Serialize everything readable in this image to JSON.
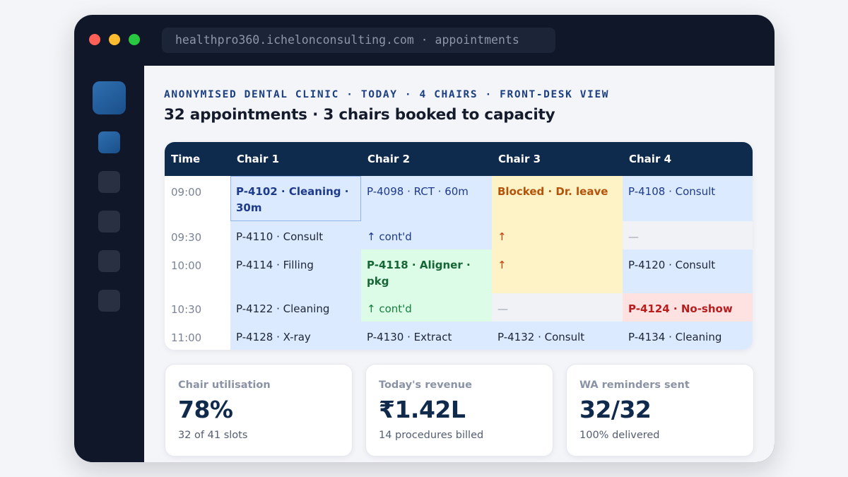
{
  "window": {
    "url": "healthpro360.ichelonconsulting.com · appointments"
  },
  "header": {
    "kicker": "ANONYMISED DENTAL CLINIC · TODAY · 4 CHAIRS · FRONT-DESK VIEW",
    "title": "32 appointments · 3 chairs booked to capacity"
  },
  "schedule": {
    "columns": [
      "Time",
      "Chair 1",
      "Chair 2",
      "Chair 3",
      "Chair 4"
    ],
    "rows": [
      {
        "time": "09:00",
        "cells": [
          "P-4102 · Cleaning · 30m",
          "P-4098 · RCT · 60m",
          "Blocked · Dr. leave",
          "P-4108 · Consult"
        ]
      },
      {
        "time": "09:30",
        "cells": [
          "P-4110 · Consult",
          "↑ cont'd",
          "↑",
          "—"
        ]
      },
      {
        "time": "10:00",
        "cells": [
          "P-4114 · Filling",
          "P-4118 · Aligner · pkg",
          "↑",
          "P-4120 · Consult"
        ]
      },
      {
        "time": "10:30",
        "cells": [
          "P-4122 · Cleaning",
          "↑ cont'd",
          "—",
          "P-4124 · No-show"
        ]
      },
      {
        "time": "11:00",
        "cells": [
          "P-4128 · X-ray",
          "P-4130 · Extract",
          "P-4132 · Consult",
          "P-4134 · Cleaning"
        ]
      }
    ]
  },
  "stats": [
    {
      "label": "Chair utilisation",
      "value": "78%",
      "sub": "32 of 41 slots"
    },
    {
      "label": "Today's revenue",
      "value": "₹1.42L",
      "sub": "14 procedures billed"
    },
    {
      "label": "WA reminders sent",
      "value": "32/32",
      "sub": "100% delivered"
    }
  ],
  "colors": {
    "booked": "#dbeafe",
    "package": "#dcfce7",
    "blocked": "#fef3c7",
    "empty": "#f1f2f5",
    "no_show": "#fee2e2",
    "header": "#0e2a4c"
  }
}
